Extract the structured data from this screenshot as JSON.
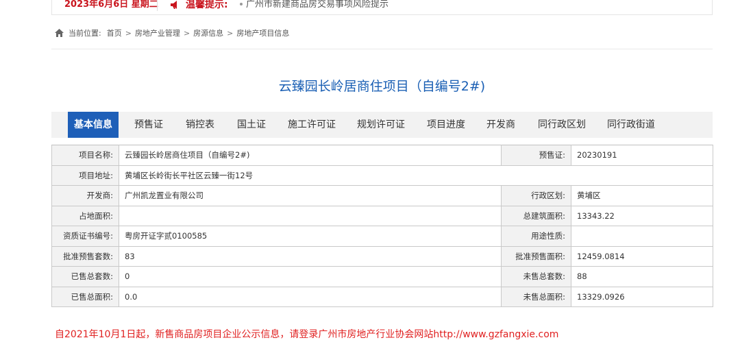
{
  "topbar": {
    "date": "2023年6月6日 星期二",
    "tip_label": "温馨提示:",
    "notice": "广州市新建商品房交易事项风险提示"
  },
  "breadcrumb": {
    "prefix": "当前位置:",
    "items": [
      "首页",
      "房地产业管理",
      "房源信息",
      "房地产项目信息"
    ]
  },
  "project_title": "云臻园长岭居商住项目（自编号2#)",
  "tabs": [
    "基本信息",
    "预售证",
    "销控表",
    "国土证",
    "施工许可证",
    "规划许可证",
    "项目进度",
    "开发商",
    "同行政区划",
    "同行政街道"
  ],
  "info": {
    "name_label": "项目名称:",
    "name": "云臻园长岭居商住项目（自编号2#)",
    "presale_label": "预售证:",
    "presale": "20230191",
    "address_label": "项目地址:",
    "address": "黄埔区长岭街长平社区云臻一街12号",
    "developer_label": "开发商:",
    "developer": "广州凯龙置业有限公司",
    "district_label": "行政区划:",
    "district": "黄埔区",
    "land_area_label": "占地面积:",
    "land_area": "",
    "total_build_label": "总建筑面积:",
    "total_build": "13343.22",
    "cert_label": "资质证书编号:",
    "cert": "粤房开证字贰0100585",
    "usage_label": "用途性质:",
    "usage": "",
    "approved_units_label": "批准预售套数:",
    "approved_units": "83",
    "approved_area_label": "批准预售面积:",
    "approved_area": "12459.0814",
    "sold_units_label": "已售总套数:",
    "sold_units": "0",
    "unsold_units_label": "未售总套数:",
    "unsold_units": "88",
    "sold_area_label": "已售总面积:",
    "sold_area": "0.0",
    "unsold_area_label": "未售总面积:",
    "unsold_area": "13329.0926"
  },
  "footnote": "自2021年10月1日起，新售商品房项目企业公示信息，请登录广州市房地产行业协会网站http://www.gzfangxie.com",
  "colors": {
    "accent_red": "#c9151e",
    "title_blue": "#1a5fb4",
    "tab_active": "#1e5fb8",
    "footnote_red": "#e02020"
  }
}
